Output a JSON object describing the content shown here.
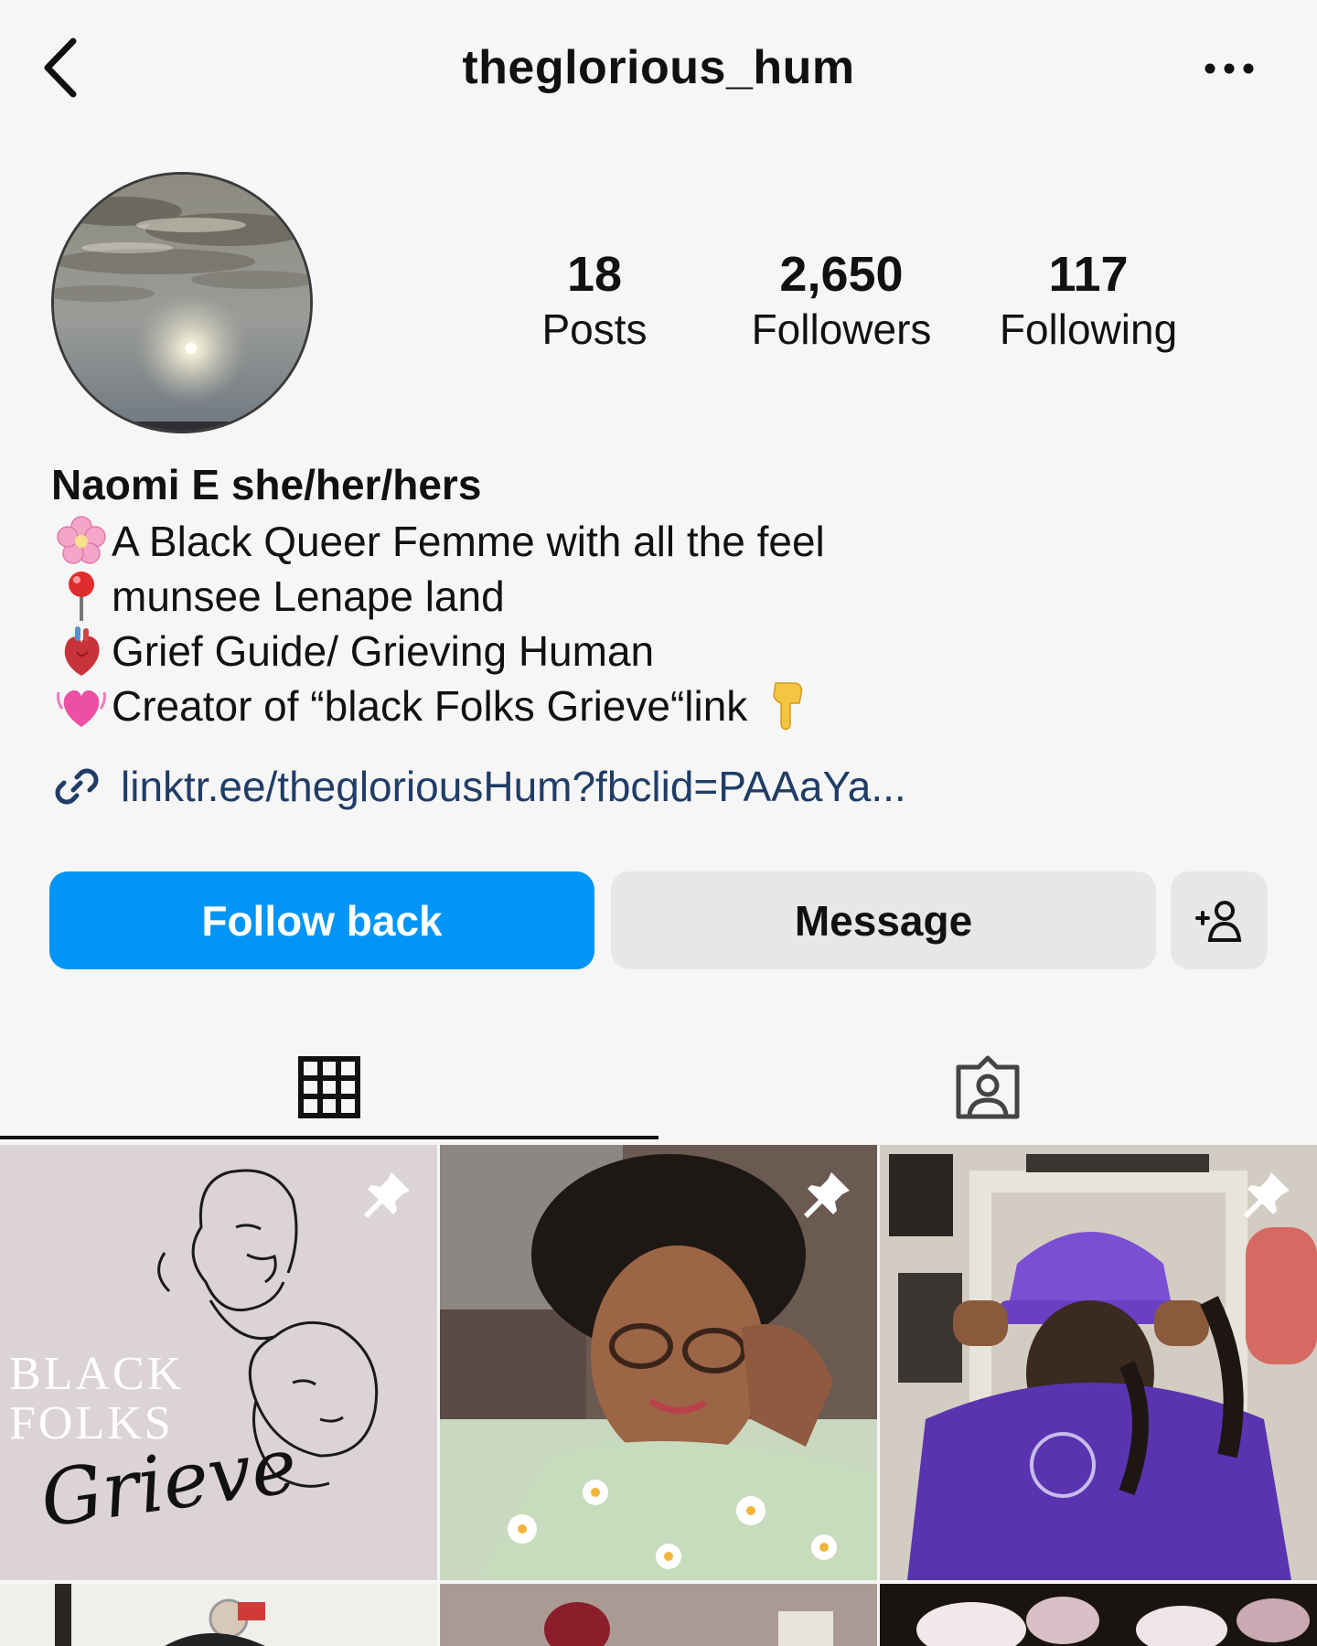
{
  "header": {
    "username": "theglorious_hum"
  },
  "stats": {
    "posts": {
      "value": "18",
      "label": "Posts"
    },
    "followers": {
      "value": "2,650",
      "label": "Followers"
    },
    "following": {
      "value": "117",
      "label": "Following"
    }
  },
  "bio": {
    "name": "Naomi E she/her/hers",
    "lines": [
      {
        "emoji": "cherry-blossom",
        "text": "A Black Queer Femme with all the feel"
      },
      {
        "emoji": "round-pushpin",
        "text": " munsee Lenape land"
      },
      {
        "emoji": "anatomical-heart",
        "text": "Grief Guide/ Grieving Human"
      },
      {
        "emoji": "growing-heart",
        "text": "Creator of “black Folks Grieve“link"
      }
    ],
    "link": "linktr.ee/thegloriousHum?fbclid=PAAaYa..."
  },
  "buttons": {
    "follow_back": "Follow back",
    "message": "Message"
  },
  "tabs": [
    {
      "name": "posts-grid",
      "icon": "grid-icon",
      "active": true
    },
    {
      "name": "tagged",
      "icon": "tagged-user-icon",
      "active": false
    }
  ],
  "posts": [
    {
      "pinned": true,
      "caption_lines": [
        "BLACK",
        "FOLKS"
      ],
      "script": "Grieve"
    },
    {
      "pinned": true
    },
    {
      "pinned": true
    },
    {
      "pinned": false
    },
    {
      "pinned": false
    },
    {
      "pinned": false
    }
  ],
  "colors": {
    "background": "#f6f6f6",
    "follow_button": "#0095f6",
    "secondary_button": "#e7e7e7",
    "link": "#1f3d66"
  }
}
